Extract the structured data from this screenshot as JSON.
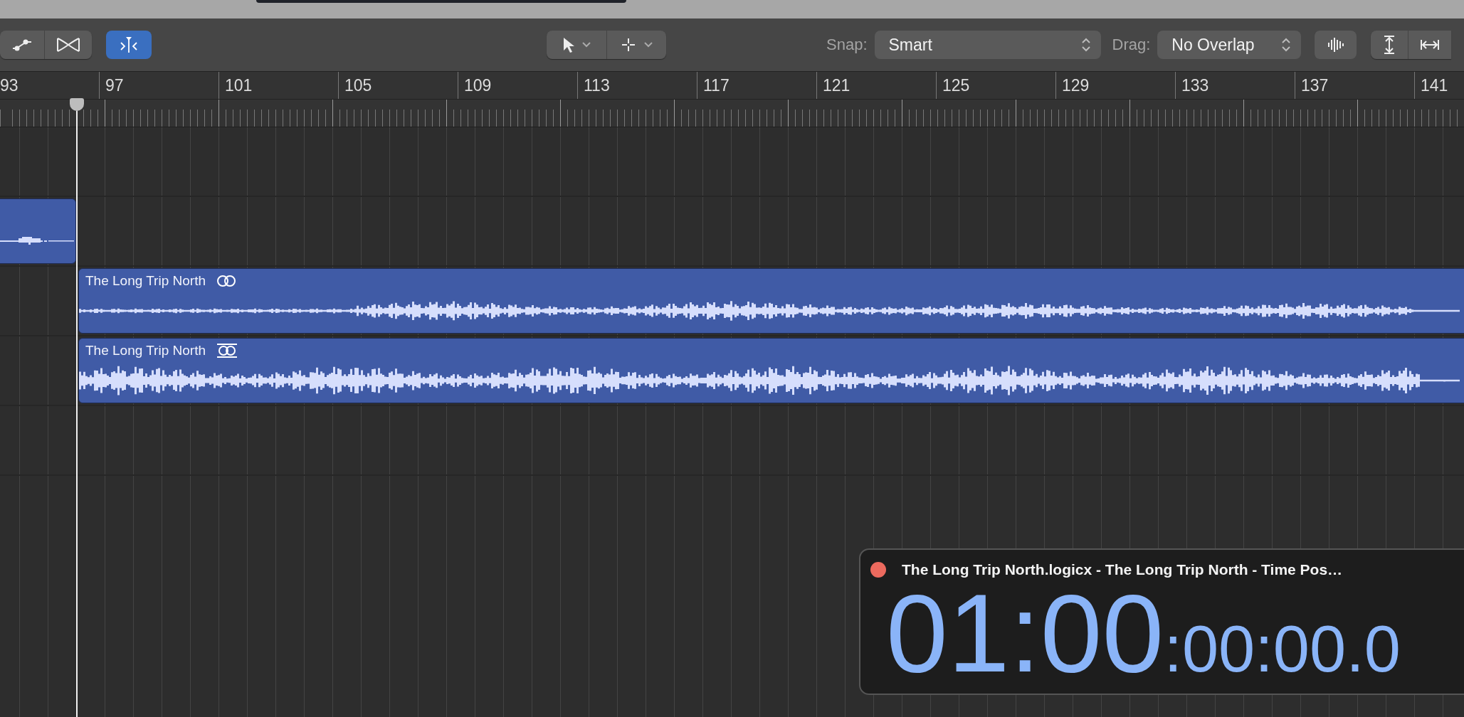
{
  "toolbar": {
    "catch_button": {
      "on": true
    },
    "snap": {
      "label": "Snap:",
      "value": "Smart"
    },
    "drag": {
      "label": "Drag:",
      "value": "No Overlap"
    }
  },
  "ruler": {
    "bars": [
      "93",
      "97",
      "101",
      "105",
      "109",
      "113",
      "117",
      "121",
      "125",
      "129",
      "133",
      "137",
      "141"
    ]
  },
  "tracks": [
    {
      "kind": "empty"
    },
    {
      "kind": "clip"
    },
    {
      "kind": "titled",
      "title": "The Long Trip North"
    },
    {
      "kind": "titled",
      "title": "The Long Trip North"
    },
    {
      "kind": "empty"
    }
  ],
  "time_window": {
    "title": "The Long Trip North.logicx - The Long Trip North - Time Pos…",
    "time_major": "01:00",
    "time_minor": ":00:00.0"
  }
}
